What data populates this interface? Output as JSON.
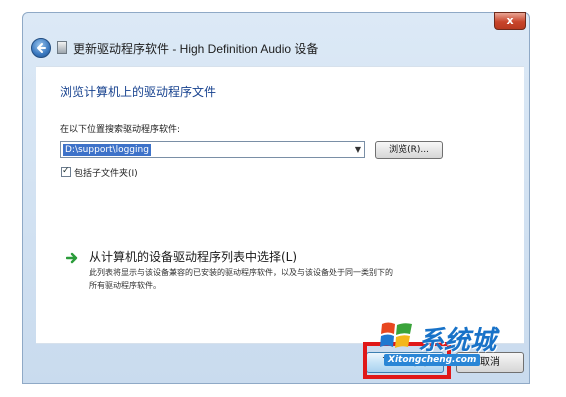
{
  "window": {
    "title": "更新驱动程序软件 - High Definition Audio 设备",
    "close_label": "x"
  },
  "content": {
    "heading": "浏览计算机上的驱动程序文件",
    "search_label": "在以下位置搜索驱动程序软件:",
    "path_value": "D:\\support\\logging",
    "browse_label": "浏览(R)...",
    "include_subfolders_label": "包括子文件夹(I)",
    "include_subfolders_checked": true,
    "pick_title": "从计算机的设备驱动程序列表中选择(L)",
    "pick_desc_line1": "此列表将显示与该设备兼容的已安装的驱动程序软件，以及与该设备处于同一类别下的",
    "pick_desc_line2": "所有驱动程序软件。"
  },
  "footer": {
    "next_label": "下一步(N)",
    "cancel_label": "取消"
  },
  "watermark": {
    "text": "系统城",
    "url": "Xitongcheng.com"
  },
  "colors": {
    "heading": "#17428f",
    "highlight": "#e01818",
    "watermark": "#1872c8"
  }
}
